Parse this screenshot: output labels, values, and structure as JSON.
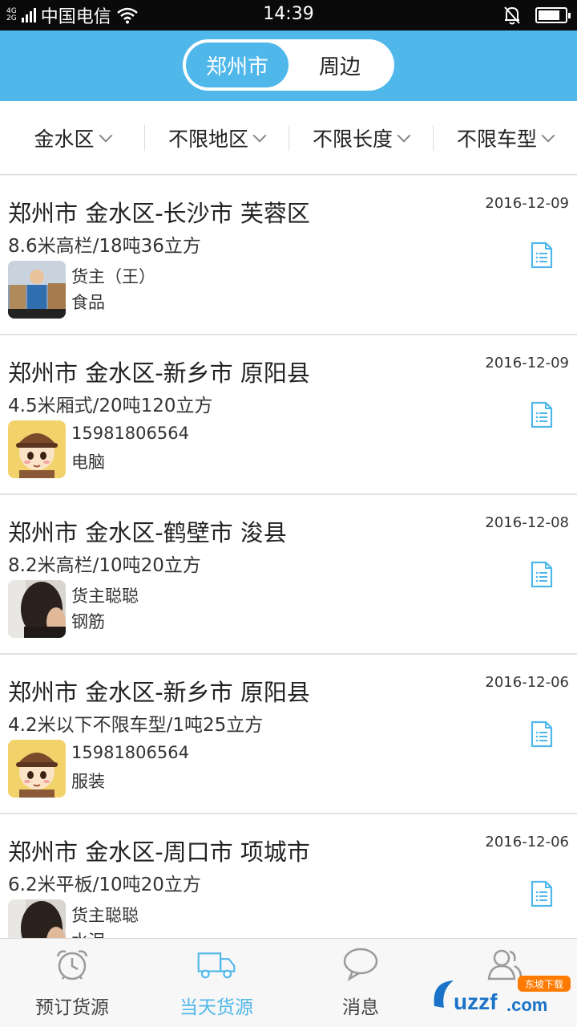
{
  "status_bar": {
    "network_top": "4G",
    "network_bottom": "2G",
    "carrier": "中国电信",
    "time": "14:39",
    "battery_level": 0.8
  },
  "header": {
    "tabs": [
      {
        "label": "郑州市",
        "active": true
      },
      {
        "label": "周边",
        "active": false
      }
    ]
  },
  "filters": [
    {
      "label": "金水区"
    },
    {
      "label": "不限地区"
    },
    {
      "label": "不限长度"
    },
    {
      "label": "不限车型"
    }
  ],
  "listings": [
    {
      "route": "郑州市 金水区-长沙市 芙蓉区",
      "spec": "8.6米高栏/18吨36立方",
      "date": "2016-12-09",
      "owner": "货主（王）",
      "goods": "食品",
      "avatar": "warehouse-worker"
    },
    {
      "route": "郑州市 金水区-新乡市 原阳县",
      "spec": "4.5米厢式/20吨120立方",
      "date": "2016-12-09",
      "owner": "15981806564",
      "goods": "电脑",
      "avatar": "cartoon-courier"
    },
    {
      "route": "郑州市 金水区-鹤壁市 浚县",
      "spec": "8.2米高栏/10吨20立方",
      "date": "2016-12-08",
      "owner": "货主聪聪",
      "goods": "钢筋",
      "avatar": "woman-photo"
    },
    {
      "route": "郑州市 金水区-新乡市 原阳县",
      "spec": "4.2米以下不限车型/1吨25立方",
      "date": "2016-12-06",
      "owner": "15981806564",
      "goods": "服装",
      "avatar": "cartoon-courier"
    },
    {
      "route": "郑州市 金水区-周口市 项城市",
      "spec": "6.2米平板/10吨20立方",
      "date": "2016-12-06",
      "owner": "货主聪聪",
      "goods": "水泥",
      "avatar": "woman-photo"
    }
  ],
  "tabbar": [
    {
      "label": "预订货源",
      "icon": "alarm-clock-icon",
      "active": false
    },
    {
      "label": "当天货源",
      "icon": "truck-icon",
      "active": true
    },
    {
      "label": "消息",
      "icon": "chat-bubble-icon",
      "active": false
    },
    {
      "label": "",
      "icon": "contacts-icon",
      "active": false
    }
  ],
  "colors": {
    "accent": "#4fb7ea",
    "status_bar": "#0a0a0a"
  },
  "watermark": {
    "text": "uzzf.com",
    "badge": "东坡下载"
  }
}
